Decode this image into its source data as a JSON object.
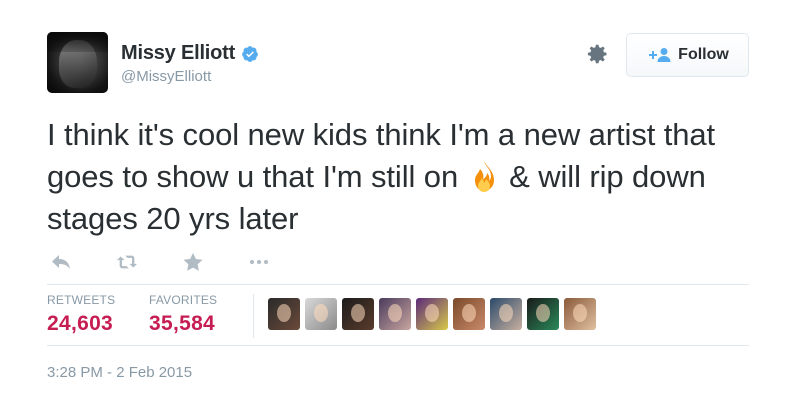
{
  "user": {
    "display_name": "Missy Elliott",
    "handle": "@MissyElliott",
    "verified": true
  },
  "follow_button": {
    "label": "Follow"
  },
  "tweet": {
    "text_part1": "I think it's cool new kids think I'm a new artist that goes to show u that I'm still on ",
    "emoji": "fire-emoji",
    "text_part2": " & will rip down stages 20 yrs later",
    "timestamp": "3:28 PM - 2 Feb 2015"
  },
  "stats": {
    "retweets_label": "RETWEETS",
    "retweets_value": "24,603",
    "favorites_label": "FAVORITES",
    "favorites_value": "35,584"
  },
  "icons": [
    "reply-icon",
    "retweet-icon",
    "favorite-icon",
    "more-icon",
    "gear-icon",
    "verified-icon",
    "follow-user-icon"
  ],
  "favoriters": [
    {
      "bg": "#2a2a2a",
      "accent": "#6b4a3a"
    },
    {
      "bg": "#d9d9d9",
      "accent": "#8a8a8a"
    },
    {
      "bg": "#1c1c1c",
      "accent": "#5a3b2c"
    },
    {
      "bg": "#4a3b5c",
      "accent": "#c9a6a0"
    },
    {
      "bg": "#5c2a7a",
      "accent": "#d8c94a"
    },
    {
      "bg": "#7a4a2a",
      "accent": "#c98a6a"
    },
    {
      "bg": "#2a4a6a",
      "accent": "#c9b0a0"
    },
    {
      "bg": "#1a1a1a",
      "accent": "#2a8a5a"
    },
    {
      "bg": "#8a5a3a",
      "accent": "#e0c0a0"
    }
  ],
  "colors": {
    "stat_value": "#c61d53",
    "muted": "#8899a6",
    "verified_blue": "#55acee",
    "text": "#292f33"
  }
}
